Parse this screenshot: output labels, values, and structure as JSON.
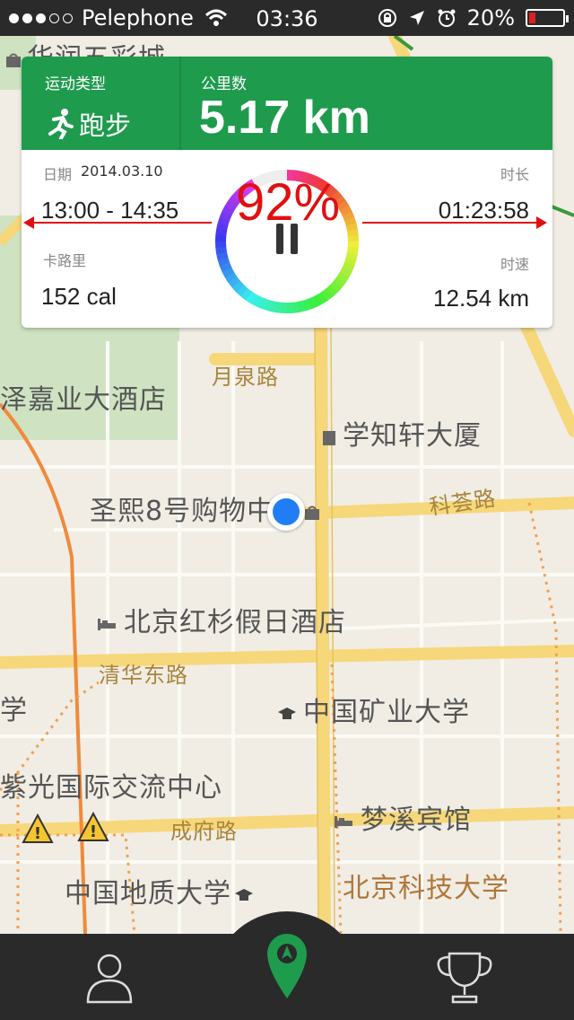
{
  "status_bar": {
    "carrier": "Pelephone",
    "time": "03:36",
    "battery": "20%",
    "battery_level": 0.2
  },
  "stats": {
    "type_label": "运动类型",
    "type_value": "跑步",
    "distance_label": "公里数",
    "distance_value": "5.17 km",
    "date_label": "日期",
    "date_value": "2014.03.10",
    "time_range": "13:00 - 14:35",
    "duration_label": "时长",
    "duration_value": "01:23:58",
    "calories_label": "卡路里",
    "calories_value": "152 cal",
    "speed_label": "时速",
    "speed_value": "12.54 km",
    "progress_text": "92%",
    "progress": 0.92
  },
  "map": {
    "labels": {
      "l1": "华润五彩城",
      "l2": "泽嘉业大酒店",
      "l3": "月泉路",
      "l4": "学知轩大厦",
      "l5": "圣熙8号购物中心",
      "l6": "科荟路",
      "l7": "北京红杉假日酒店",
      "l8": "清华东路",
      "l9": "学",
      "l10": "中国矿业大学",
      "l11": "紫光国际交流中心",
      "l12": "梦溪宾馆",
      "l13": "成府路",
      "l14": "中国地质大学",
      "l15": "北京科技大学"
    }
  },
  "tabs": {
    "profile_icon": "person-icon",
    "map_icon": "location-pin-icon",
    "trophy_icon": "trophy-icon",
    "accent": "#1f9b4e"
  }
}
